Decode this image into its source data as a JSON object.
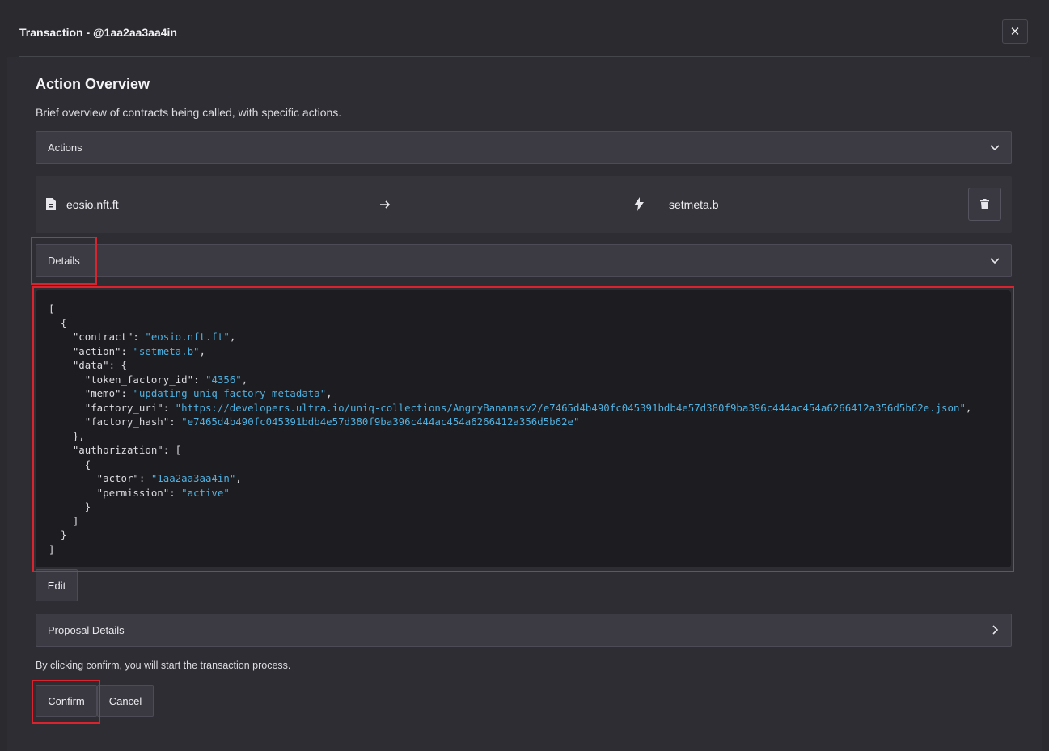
{
  "window": {
    "title": "Transaction - @1aa2aa3aa4in",
    "close_icon": "close-icon"
  },
  "overview": {
    "title": "Action Overview",
    "description": "Brief overview of contracts being called, with specific actions."
  },
  "actions_accordion": {
    "label": "Actions"
  },
  "action_item": {
    "contract": "eosio.nft.ft",
    "action": "setmeta.b",
    "icons": [
      "file-icon",
      "arrow-right-icon",
      "bolt-icon",
      "trash-icon"
    ]
  },
  "details_accordion": {
    "label": "Details"
  },
  "details_json": {
    "contract": "eosio.nft.ft",
    "action": "setmeta.b",
    "token_factory_id": "4356",
    "memo": "updating uniq factory metadata",
    "factory_uri": "https://developers.ultra.io/uniq-collections/AngryBananasv2/e7465d4b490fc045391bdb4e57d380f9ba396c444ac454a6266412a356d5b62e.json",
    "factory_hash": "e7465d4b490fc045391bdb4e57d380f9ba396c444ac454a6266412a356d5b62e",
    "actor": "1aa2aa3aa4in",
    "permission": "active"
  },
  "edit_button": "Edit",
  "proposal_accordion": {
    "label": "Proposal Details"
  },
  "confirm_note": "By clicking confirm, you will start the transaction process.",
  "buttons": {
    "confirm": "Confirm",
    "cancel": "Cancel"
  },
  "colors": {
    "background": "#2a2a2f",
    "accordion": "#3c3b44",
    "code_background": "#1d1d21",
    "string": "#4fb0e0",
    "highlight": "#d9232f"
  }
}
